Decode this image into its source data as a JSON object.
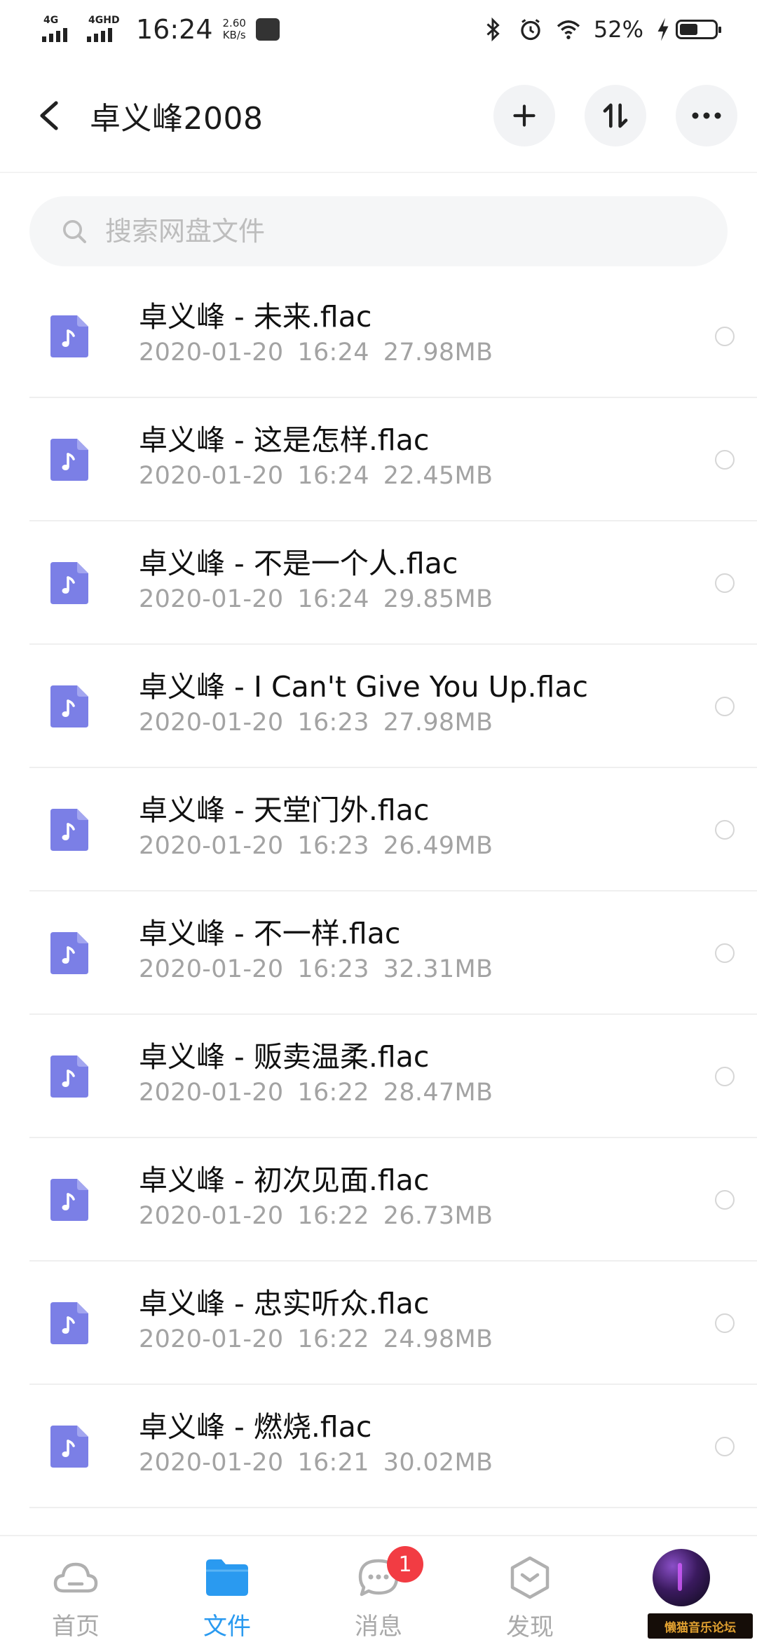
{
  "status_bar": {
    "network_1": "4G",
    "network_2": "4GHD",
    "time": "16:24",
    "speed_value": "2.60",
    "speed_unit": "KB/s",
    "battery_percent": 52,
    "battery_text": "52%",
    "icons": [
      "bluetooth-icon",
      "alarm-icon",
      "wifi-icon",
      "charging-bolt-icon",
      "battery-icon"
    ]
  },
  "header": {
    "title": "卓义峰2008",
    "actions": [
      "add-icon",
      "sort-icon",
      "more-icon"
    ]
  },
  "search": {
    "placeholder": "搜索网盘文件"
  },
  "files": [
    {
      "name": "卓义峰 - 未来.flac",
      "date": "2020-01-20",
      "time": "16:24",
      "size": "27.98MB"
    },
    {
      "name": "卓义峰 - 这是怎样.flac",
      "date": "2020-01-20",
      "time": "16:24",
      "size": "22.45MB"
    },
    {
      "name": "卓义峰 - 不是一个人.flac",
      "date": "2020-01-20",
      "time": "16:24",
      "size": "29.85MB"
    },
    {
      "name": "卓义峰 - I Can't Give You Up.flac",
      "date": "2020-01-20",
      "time": "16:23",
      "size": "27.98MB"
    },
    {
      "name": "卓义峰 - 天堂门外.flac",
      "date": "2020-01-20",
      "time": "16:23",
      "size": "26.49MB"
    },
    {
      "name": "卓义峰 - 不一样.flac",
      "date": "2020-01-20",
      "time": "16:23",
      "size": "32.31MB"
    },
    {
      "name": "卓义峰 - 贩卖温柔.flac",
      "date": "2020-01-20",
      "time": "16:22",
      "size": "28.47MB"
    },
    {
      "name": "卓义峰 - 初次见面.flac",
      "date": "2020-01-20",
      "time": "16:22",
      "size": "26.73MB"
    },
    {
      "name": "卓义峰 - 忠实听众.flac",
      "date": "2020-01-20",
      "time": "16:22",
      "size": "24.98MB"
    },
    {
      "name": "卓义峰 - 燃烧.flac",
      "date": "2020-01-20",
      "time": "16:21",
      "size": "30.02MB"
    }
  ],
  "nav": {
    "items": [
      {
        "label": "首页",
        "icon": "cloud-icon"
      },
      {
        "label": "文件",
        "icon": "folder-icon",
        "active": true
      },
      {
        "label": "消息",
        "icon": "message-icon",
        "badge": "1"
      },
      {
        "label": "发现",
        "icon": "discover-icon"
      }
    ]
  },
  "watermark": "懒猫音乐论坛",
  "colors": {
    "accent": "#2a9af0",
    "file_icon": "#7b7fe6",
    "badge": "#f23c43"
  }
}
